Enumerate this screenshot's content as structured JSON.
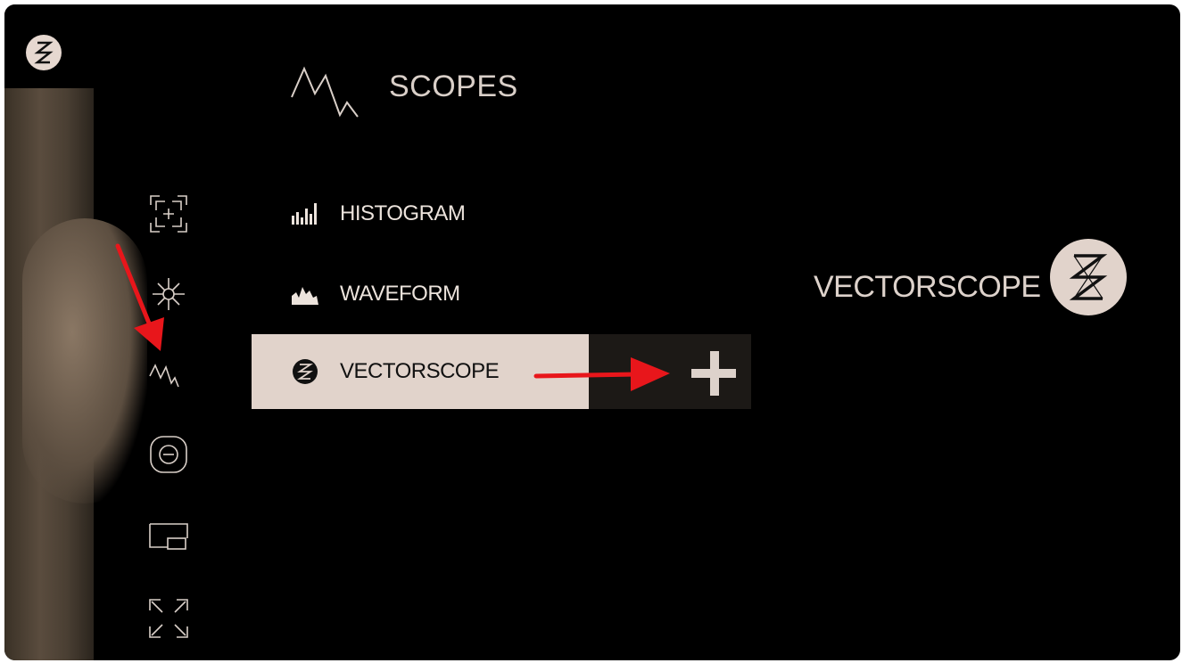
{
  "header": {
    "title": "SCOPES",
    "icon": "waveform-line-icon"
  },
  "menu": {
    "items": [
      {
        "label": "HISTOGRAM",
        "icon": "histogram-icon",
        "active": false
      },
      {
        "label": "WAVEFORM",
        "icon": "waveform-icon",
        "active": false
      },
      {
        "label": "VECTORSCOPE",
        "icon": "vectorscope-icon",
        "active": true
      }
    ]
  },
  "selected_panel": {
    "label": "VECTORSCOPE",
    "icon": "vectorscope-logo-icon"
  },
  "sidebar": {
    "icons": [
      "focus-assist-icon",
      "exposure-icon",
      "scopes-icon",
      "overlay-icon",
      "display-icon",
      "fullscreen-icon"
    ]
  },
  "add_button": {
    "icon": "plus-icon"
  },
  "colors": {
    "accent": "#e1d3cb",
    "background": "#000000",
    "annotation": "#e8161b"
  }
}
